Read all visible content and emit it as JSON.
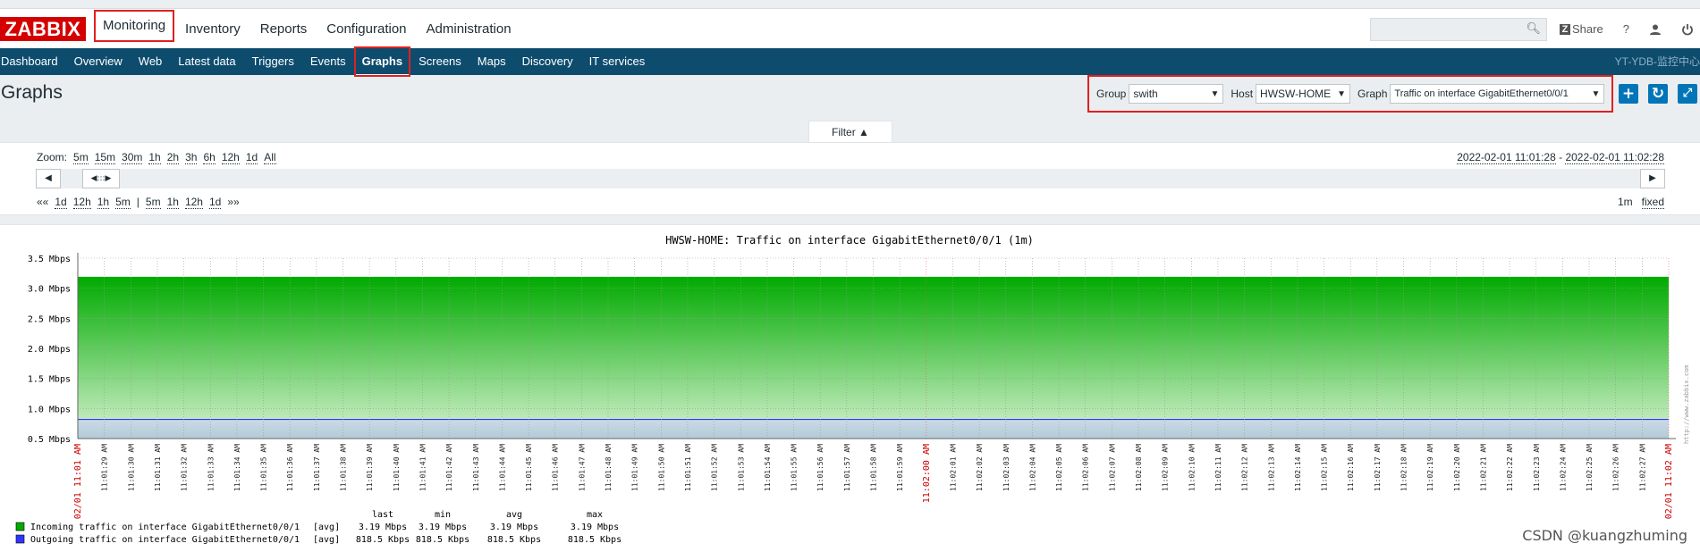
{
  "logo": "ZABBIX",
  "main_nav": [
    "Monitoring",
    "Inventory",
    "Reports",
    "Configuration",
    "Administration"
  ],
  "top_icons": {
    "share": "Share",
    "help": "?"
  },
  "sub_nav": [
    "Dashboard",
    "Overview",
    "Web",
    "Latest data",
    "Triggers",
    "Events",
    "Graphs",
    "Screens",
    "Maps",
    "Discovery",
    "IT services"
  ],
  "sub_nav_right": "YT-YDB-监控中心",
  "page_title": "Graphs",
  "controls": {
    "group_label": "Group",
    "group_value": "swith",
    "host_label": "Host",
    "host_value": "HWSW-HOME",
    "graph_label": "Graph",
    "graph_value": "Traffic on interface GigabitEthernet0/0/1"
  },
  "filter_label": "Filter ▲",
  "zoom": {
    "label": "Zoom:",
    "options": [
      "5m",
      "15m",
      "30m",
      "1h",
      "2h",
      "3h",
      "6h",
      "12h",
      "1d",
      "All"
    ]
  },
  "time_range": {
    "from": "2022-02-01 11:01:28",
    "sep": " - ",
    "to": "2022-02-01 11:02:28"
  },
  "nav_back": [
    "««",
    "1d",
    "12h",
    "1h",
    "5m",
    "|",
    "5m",
    "1h",
    "12h",
    "1d",
    "»»"
  ],
  "period": {
    "value": "1m",
    "mode": "fixed"
  },
  "chart_data": {
    "type": "area",
    "title": "HWSW-HOME: Traffic on interface GigabitEthernet0/0/1 (1m)",
    "ylim": [
      0.5,
      3.5
    ],
    "y_ticks": [
      "3.5 Mbps",
      "3.0 Mbps",
      "2.5 Mbps",
      "2.0 Mbps",
      "1.5 Mbps",
      "1.0 Mbps",
      "0.5 Mbps"
    ],
    "y_values": [
      3.5,
      3.0,
      2.5,
      2.0,
      1.5,
      1.0,
      0.5
    ],
    "x_start_label": "02/01 11:01 AM",
    "x_mid_label": "11:02:00 AM",
    "x_end_label": "02/01 11:02 AM",
    "x_ticks": [
      "11:01:29 AM",
      "11:01:30 AM",
      "11:01:31 AM",
      "11:01:32 AM",
      "11:01:33 AM",
      "11:01:34 AM",
      "11:01:35 AM",
      "11:01:36 AM",
      "11:01:37 AM",
      "11:01:38 AM",
      "11:01:39 AM",
      "11:01:40 AM",
      "11:01:41 AM",
      "11:01:42 AM",
      "11:01:43 AM",
      "11:01:44 AM",
      "11:01:45 AM",
      "11:01:46 AM",
      "11:01:47 AM",
      "11:01:48 AM",
      "11:01:49 AM",
      "11:01:50 AM",
      "11:01:51 AM",
      "11:01:52 AM",
      "11:01:53 AM",
      "11:01:54 AM",
      "11:01:55 AM",
      "11:01:56 AM",
      "11:01:57 AM",
      "11:01:58 AM",
      "11:01:59 AM",
      "11:02:00 AM",
      "11:02:01 AM",
      "11:02:02 AM",
      "11:02:03 AM",
      "11:02:04 AM",
      "11:02:05 AM",
      "11:02:06 AM",
      "11:02:07 AM",
      "11:02:08 AM",
      "11:02:09 AM",
      "11:02:10 AM",
      "11:02:11 AM",
      "11:02:12 AM",
      "11:02:13 AM",
      "11:02:14 AM",
      "11:02:15 AM",
      "11:02:16 AM",
      "11:02:17 AM",
      "11:02:18 AM",
      "11:02:19 AM",
      "11:02:20 AM",
      "11:02:21 AM",
      "11:02:22 AM",
      "11:02:23 AM",
      "11:02:24 AM",
      "11:02:25 AM",
      "11:02:26 AM",
      "11:02:27 AM"
    ],
    "series": [
      {
        "name": "Incoming traffic on interface GigabitEthernet0/0/1",
        "value_mbps": 3.19,
        "color": "#00aa00",
        "func": "[avg]",
        "last": "3.19 Mbps",
        "min": "3.19 Mbps",
        "avg": "3.19 Mbps",
        "max": "3.19 Mbps"
      },
      {
        "name": "Outgoing traffic on interface GigabitEthernet0/0/1",
        "value_mbps": 0.8185,
        "color": "#3333ff",
        "func": "[avg]",
        "last": "818.5 Kbps",
        "min": "818.5 Kbps",
        "avg": "818.5 Kbps",
        "max": "818.5 Kbps"
      }
    ],
    "legend_headers": [
      "last",
      "min",
      "avg",
      "max"
    ],
    "side_text": "http://www.zabbix.com",
    "grid": true
  },
  "watermark": "CSDN @kuangzhuming",
  "colors": {
    "accent": "#0275b8",
    "subnav": "#0e4c6e",
    "highlight": "#e02020",
    "brand": "#d40000"
  }
}
